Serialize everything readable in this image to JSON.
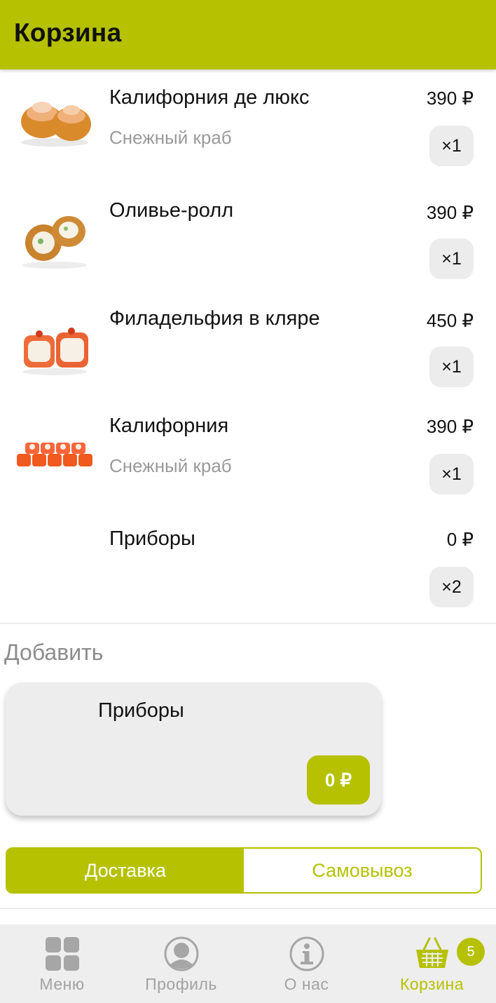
{
  "header": {
    "title": "Корзина"
  },
  "cart": {
    "items": [
      {
        "name": "Калифорния де люкс",
        "subtitle": "Снежный краб",
        "price": "390 ₽",
        "qty": "×1",
        "image": "sushi-image"
      },
      {
        "name": " Оливье-ролл",
        "subtitle": "",
        "price": "390 ₽",
        "qty": "×1",
        "image": "sushi-image"
      },
      {
        "name": "Филадельфия в кляре",
        "subtitle": "",
        "price": "450 ₽",
        "qty": "×1",
        "image": "sushi-image"
      },
      {
        "name": "Калифорния",
        "subtitle": "Снежный краб",
        "price": "390 ₽",
        "qty": "×1",
        "image": "sushi-image"
      },
      {
        "name": "Приборы",
        "subtitle": "",
        "price": "0 ₽",
        "qty": "×2",
        "image": ""
      }
    ]
  },
  "add_section": {
    "label": "Добавить",
    "card": {
      "name": "Приборы",
      "price": "0 ₽"
    }
  },
  "delivery_toggle": {
    "options": [
      {
        "label": "Доставка",
        "active": true
      },
      {
        "label": "Самовывоз",
        "active": false
      }
    ]
  },
  "bottom_nav": {
    "items": [
      {
        "label": "Меню",
        "icon": "grid-icon",
        "active": false
      },
      {
        "label": "Профиль",
        "icon": "profile-icon",
        "active": false
      },
      {
        "label": "О нас",
        "icon": "info-icon",
        "active": false
      },
      {
        "label": "Корзина",
        "icon": "basket-icon",
        "active": true
      }
    ],
    "cart_badge": "5"
  },
  "colors": {
    "accent": "#b5c101",
    "chip": "#ececec",
    "nav_bg": "#eeeeee",
    "muted_text": "#9a9a9a"
  }
}
